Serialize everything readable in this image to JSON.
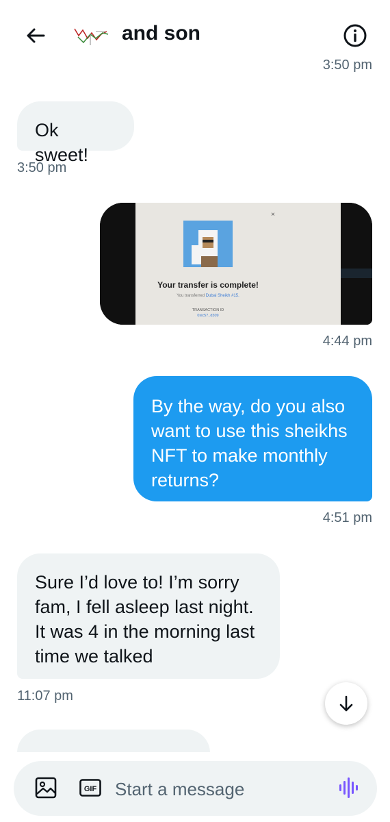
{
  "header": {
    "title": "and son"
  },
  "messages": [
    {
      "direction": "incoming",
      "text": "Ok sweet!",
      "time": "3:50 pm"
    },
    {
      "direction": "outgoing",
      "type": "image",
      "time": "4:44 pm",
      "image_text": {
        "close": "×",
        "headline": "Your transfer is complete!",
        "subline_prefix": "You transferred ",
        "subline_link": "Dubai Sheikh #15.",
        "tx_label": "TRANSACTION ID",
        "tx_value": "0xic57..d309"
      }
    },
    {
      "direction": "outgoing",
      "lines": [
        "By the way, do you also",
        "want to use this sheikhs",
        "NFT to make monthly",
        "returns?"
      ],
      "time": "4:51 pm"
    },
    {
      "direction": "incoming",
      "lines": [
        "Sure I’d love to! I’m sorry",
        "fam, I fell asleep last night.",
        "It was 4 in the morning last",
        "time we talked"
      ],
      "time": "11:07 pm"
    }
  ],
  "top_time": "3:50 pm",
  "composer": {
    "placeholder": "Start a message",
    "gif_label": "GIF"
  },
  "colors": {
    "accent": "#1d9bf0",
    "incoming_bubble": "#eff3f4",
    "secondary_text": "#536471",
    "voice_icon": "#7856ff"
  },
  "icons": [
    "back-arrow-icon",
    "info-icon",
    "image-icon",
    "gif-icon",
    "voice-wave-icon",
    "arrow-down-icon"
  ]
}
